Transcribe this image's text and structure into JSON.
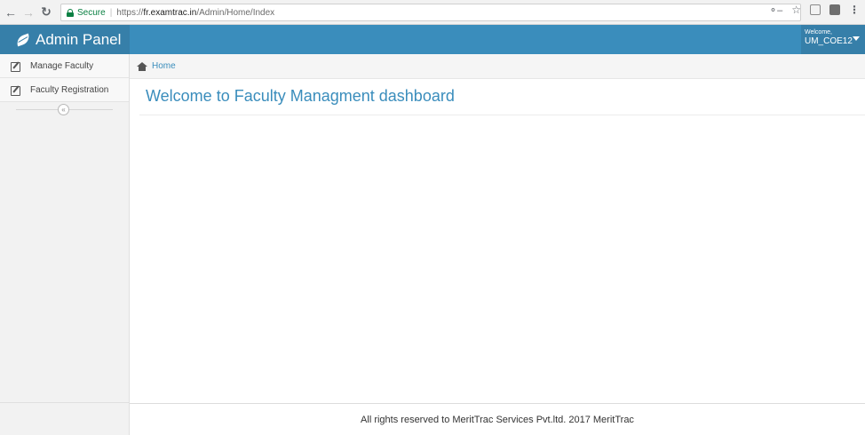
{
  "browser": {
    "back_icon": "arrow-left-icon",
    "forward_icon": "arrow-right-icon",
    "reload_icon": "reload-icon",
    "secure_label": "Secure",
    "url_scheme": "https://",
    "url_host": "fr.examtrac.in",
    "url_path": "/Admin/Home/Index",
    "right_icons": [
      "key-icon",
      "star-icon",
      "extension-icon",
      "extension-icon",
      "menu-icon"
    ]
  },
  "header": {
    "brand": "Admin Panel",
    "brand_icon": "leaf-icon",
    "user_welcome": "Welcome,",
    "user_name": "UM_COE12",
    "bg_color": "#3a8dbc",
    "brand_bg_color": "#367fa9"
  },
  "sidebar": {
    "items": [
      {
        "label": "Manage Faculty",
        "icon": "edit-icon"
      },
      {
        "label": "Faculty Registration",
        "icon": "edit-icon"
      }
    ],
    "collapse_symbol": "«"
  },
  "breadcrumb": {
    "icon": "home-icon",
    "label": "Home"
  },
  "main": {
    "title": "Welcome to Faculty Managment dashboard"
  },
  "footer": {
    "text": "All rights reserved to MeritTrac Services Pvt.ltd. 2017 MeritTrac"
  }
}
